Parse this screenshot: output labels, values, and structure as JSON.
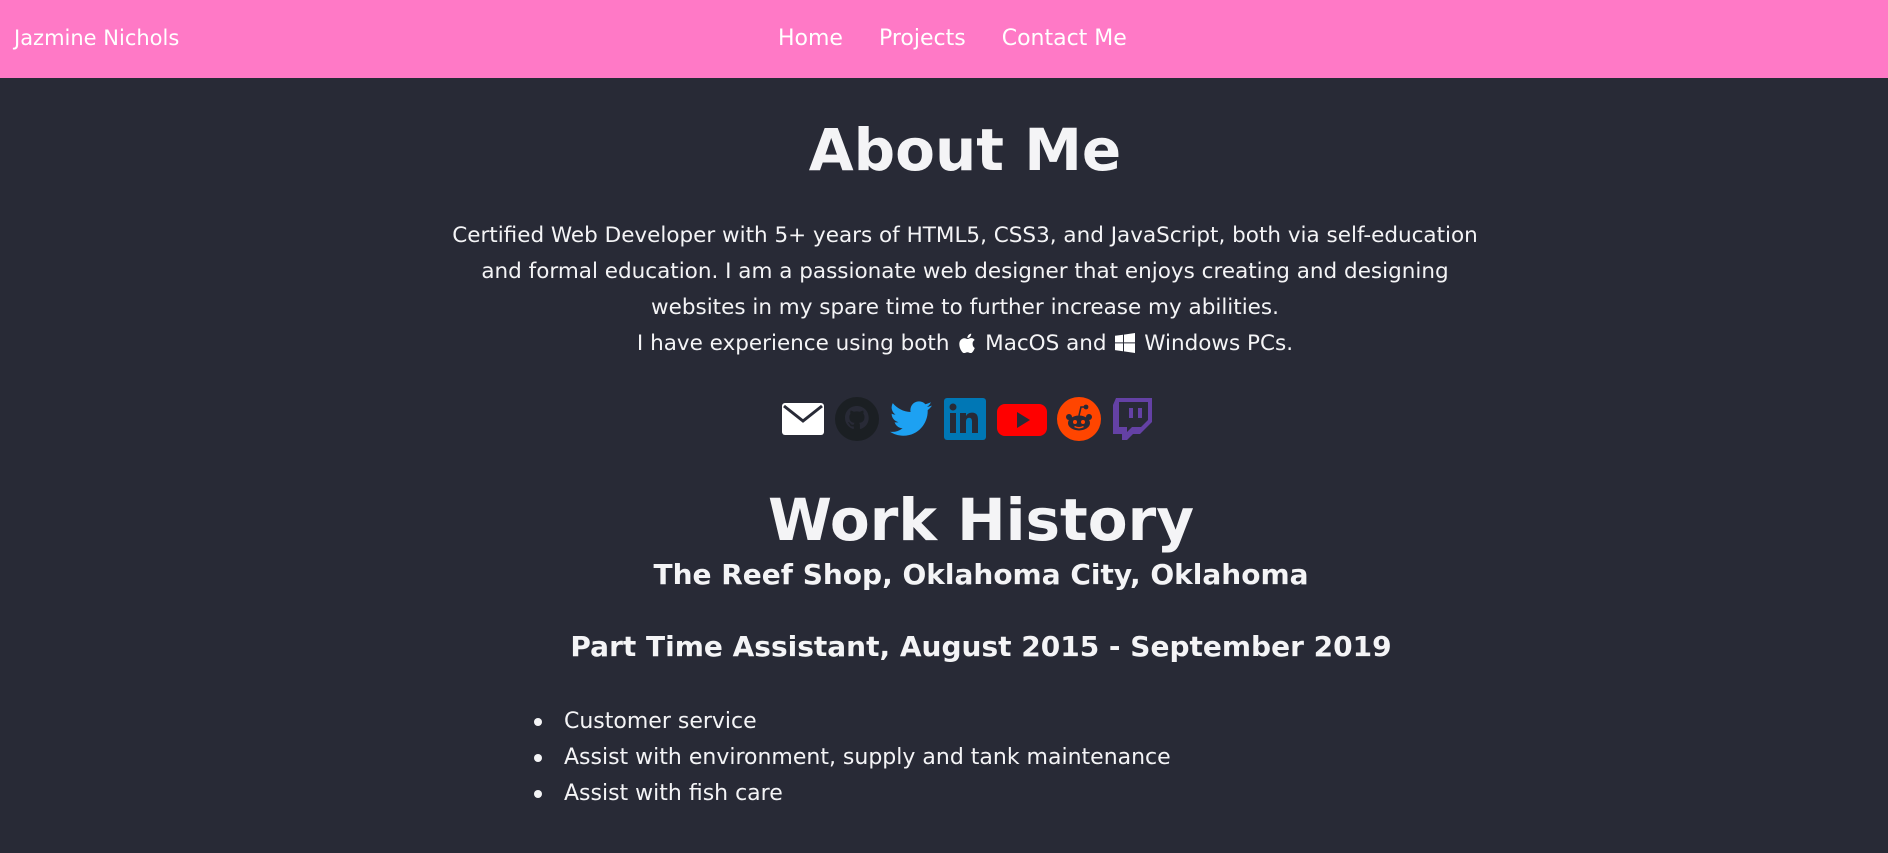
{
  "nav": {
    "brand": "Jazmine Nichols",
    "links": [
      "Home",
      "Projects",
      "Contact Me"
    ]
  },
  "about": {
    "heading": "About Me",
    "bio": "Certified Web Developer with 5+ years of HTML5, CSS3, and JavaScript, both via self-education and formal education. I am a passionate web designer that enjoys creating and designing websites in my spare time to further increase my abilities.",
    "experience_prefix": "I have experience using both",
    "macos_label": "MacOS and",
    "windows_label": "Windows PCs."
  },
  "socials": [
    {
      "name": "email-icon",
      "color": "#ffffff"
    },
    {
      "name": "github-icon",
      "color": "#1b1f23"
    },
    {
      "name": "twitter-icon",
      "color": "#1da1f2"
    },
    {
      "name": "linkedin-icon",
      "color": "#0077b5"
    },
    {
      "name": "youtube-icon",
      "color": "#ff0000"
    },
    {
      "name": "reddit-icon",
      "color": "#ff4500"
    },
    {
      "name": "twitch-icon",
      "color": "#6441a5"
    }
  ],
  "work": {
    "heading": "Work History",
    "employer": "The Reef Shop, Oklahoma City, Oklahoma",
    "position": "Part Time Assistant, August 2015 - September 2019",
    "duties": [
      "Customer service",
      "Assist with environment, supply and tank maintenance",
      "Assist with fish care"
    ]
  },
  "colors": {
    "navbar": "#ff79c6",
    "background": "#282a36",
    "text": "#f4f4f6"
  }
}
